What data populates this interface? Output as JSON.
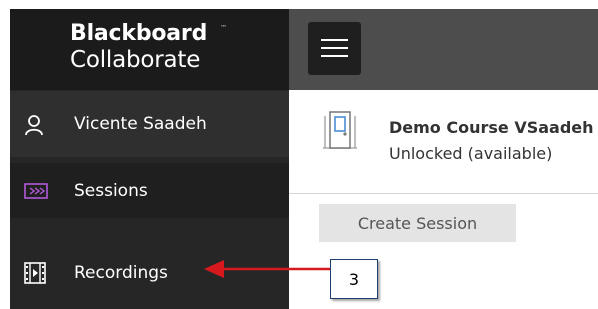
{
  "brand": {
    "line1": "Blackboard",
    "line2": "Collaborate",
    "trademark": "™"
  },
  "sidebar": {
    "items": [
      {
        "label": "Vicente Saadeh",
        "icon": "user-icon"
      },
      {
        "label": "Sessions",
        "icon": "video-session-icon"
      },
      {
        "label": "Recordings",
        "icon": "film-icon"
      }
    ]
  },
  "course": {
    "title": "Demo Course VSaadeh",
    "status": "Unlocked (available)"
  },
  "actions": {
    "create_session": "Create Session"
  },
  "annotation": {
    "callout_number": "3"
  },
  "colors": {
    "sidebar_bg": "#262626",
    "topbar_bg": "#4d4d4d",
    "sessions_icon": "#b35ad9",
    "arrow": "#d6191c",
    "callout_border": "#1c3e6e"
  }
}
